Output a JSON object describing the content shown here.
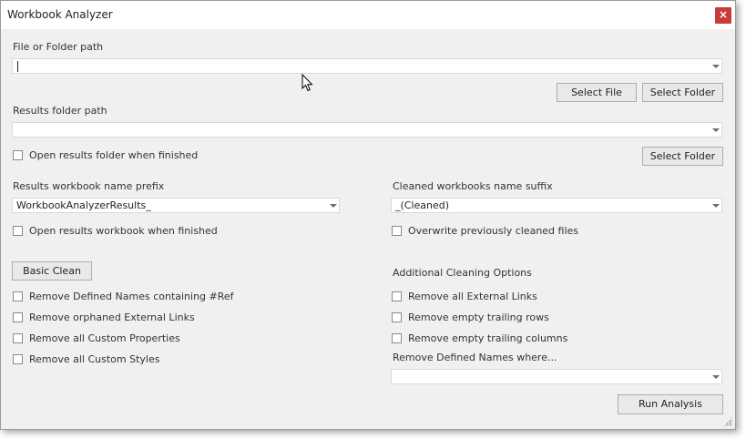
{
  "window": {
    "title": "Workbook Analyzer",
    "close_label": "×"
  },
  "file_path": {
    "label": "File or Folder path",
    "value": "",
    "select_file_label": "Select File",
    "select_folder_label": "Select Folder"
  },
  "results_path": {
    "label": "Results folder path",
    "value": "",
    "open_when_finished_label": "Open results folder when finished",
    "select_folder_label": "Select Folder"
  },
  "results_prefix": {
    "label": "Results workbook name prefix",
    "value": "WorkbookAnalyzerResults_",
    "open_when_finished_label": "Open results workbook when finished"
  },
  "cleaned_suffix": {
    "label": "Cleaned workbooks name suffix",
    "value": "_(Cleaned)",
    "overwrite_label": "Overwrite previously cleaned files"
  },
  "basic_clean": {
    "button_label": "Basic Clean",
    "options": [
      "Remove Defined Names containing #Ref",
      "Remove orphaned External Links",
      "Remove all Custom Properties",
      "Remove all Custom Styles"
    ]
  },
  "additional_cleaning": {
    "heading": "Additional Cleaning Options",
    "options": [
      "Remove all External Links",
      "Remove empty trailing rows",
      "Remove empty trailing columns"
    ],
    "defined_names_label": "Remove Defined Names where...",
    "defined_names_value": ""
  },
  "run_button_label": "Run Analysis"
}
